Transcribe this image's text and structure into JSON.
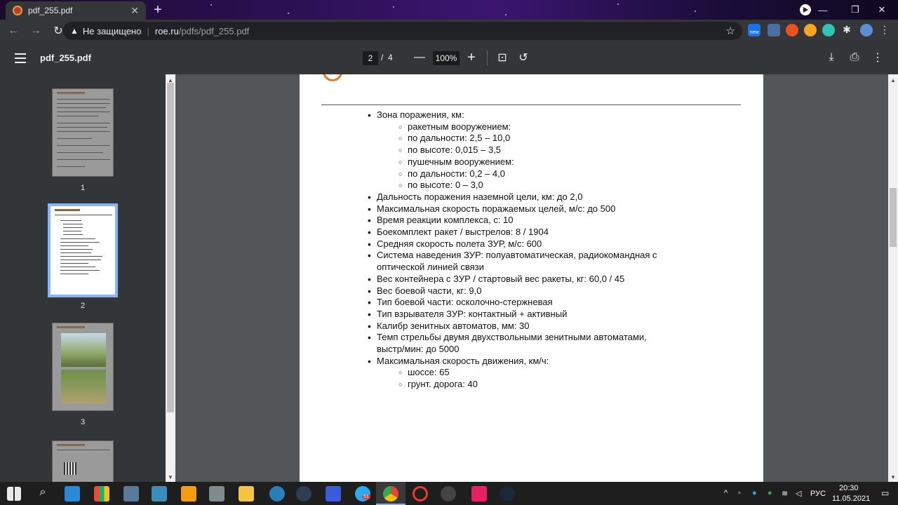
{
  "browser": {
    "tab_title": "pdf_255.pdf",
    "new_tab": "+",
    "security_label": "Не защищено",
    "url_host": "roe.ru",
    "url_path": "/pdfs/pdf_255.pdf",
    "ext_badge": "new"
  },
  "pdf_toolbar": {
    "doc_name": "pdf_255.pdf",
    "current_page": "2",
    "page_separator": "/",
    "total_pages": "4",
    "zoom": "100%"
  },
  "thumbnails": [
    {
      "label": "1"
    },
    {
      "label": "2"
    },
    {
      "label": "3"
    },
    {
      "label": ""
    }
  ],
  "content": {
    "items": [
      {
        "level": 1,
        "text": "Зона поражения, км:"
      },
      {
        "level": 2,
        "text": "ракетным вооружением:"
      },
      {
        "level": 2,
        "text": "по дальности: 2,5 – 10,0"
      },
      {
        "level": 2,
        "text": "по высоте: 0,015 – 3,5"
      },
      {
        "level": 2,
        "text": "пушечным вооружением:"
      },
      {
        "level": 2,
        "text": "по дальности: 0,2 – 4,0"
      },
      {
        "level": 2,
        "text": "по высоте: 0 – 3,0"
      },
      {
        "level": 1,
        "text": "Дальность поражения наземной цели, км:   до 2,0"
      },
      {
        "level": 1,
        "text": "Максимальная скорость поражаемых целей, м/с:   до 500"
      },
      {
        "level": 1,
        "text": "Время реакции комплекса, с:   10"
      },
      {
        "level": 1,
        "text": "Боекомплект ракет / выстрелов:   8 / 1904"
      },
      {
        "level": 1,
        "text": "Средняя скорость полета ЗУР, м/с:   600"
      },
      {
        "level": 1,
        "text": "Система наведения ЗУР:   полуавтоматическая, радиокомандная с"
      },
      {
        "level": 0,
        "text": "оптической линией связи"
      },
      {
        "level": 1,
        "text": "Вес контейнера с ЗУР / стартовый вес ракеты, кг:   60,0 / 45"
      },
      {
        "level": 1,
        "text": "Вес боевой части, кг:   9,0"
      },
      {
        "level": 1,
        "text": "Тип боевой части:   осколочно-стержневая"
      },
      {
        "level": 1,
        "text": "Тип взрывателя ЗУР:   контактный + активный"
      },
      {
        "level": 1,
        "text": "Калибр зенитных автоматов, мм:   30"
      },
      {
        "level": 1,
        "text": "Темп стрельбы двумя двухствольными зенитными автоматами,"
      },
      {
        "level": 0,
        "text": "выстр/мин:   до 5000"
      },
      {
        "level": 1,
        "text": "Максимальная скорость движения, км/ч:"
      },
      {
        "level": 2,
        "text": "шоссе: 65"
      },
      {
        "level": 2,
        "text": "грунт. дорога: 40"
      }
    ]
  },
  "taskbar": {
    "lang": "РУС",
    "time": "20:30",
    "date": "11.05.2021",
    "telegram_badge": "51"
  },
  "colors": {
    "tab_strip_accent": "#3b1570",
    "pdf_toolbar": "#323639",
    "viewer_bg": "#525659",
    "selected_thumb_border": "#8ab4f8"
  }
}
